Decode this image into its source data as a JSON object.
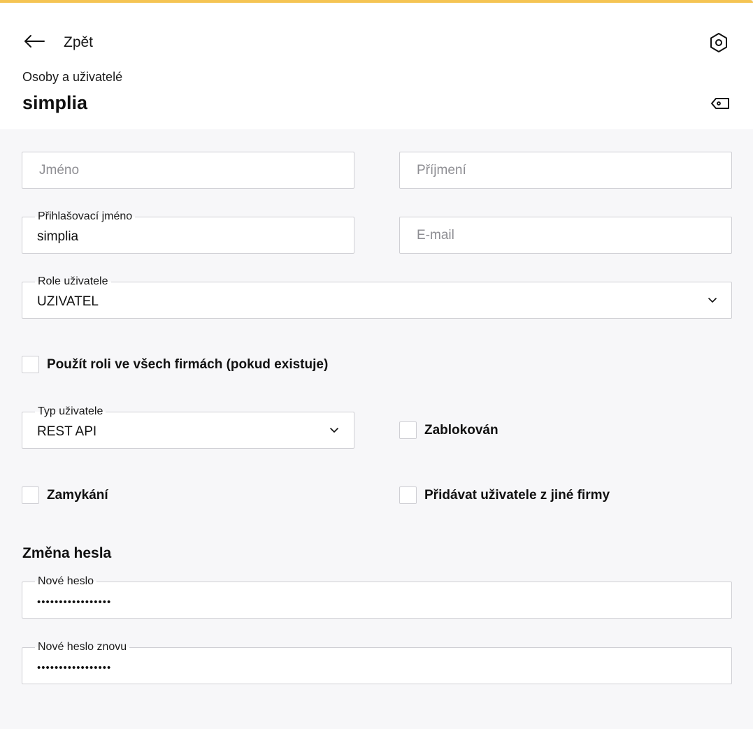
{
  "header": {
    "back_label": "Zpět",
    "subtitle": "Osoby a uživatelé",
    "title": "simplia",
    "settings_icon": "gear-hex-icon",
    "tag_icon": "tag-icon"
  },
  "form": {
    "first_name": {
      "placeholder": "Jméno",
      "value": ""
    },
    "last_name": {
      "placeholder": "Příjmení",
      "value": ""
    },
    "login": {
      "label": "Přihlašovací jméno",
      "value": "simplia"
    },
    "email": {
      "placeholder": "E-mail",
      "value": ""
    },
    "role": {
      "label": "Role uživatele",
      "value": "UZIVATEL"
    },
    "use_role_all_companies": {
      "label": "Použít roli ve všech firmách (pokud existuje)",
      "checked": false
    },
    "user_type": {
      "label": "Typ uživatele",
      "value": "REST API"
    },
    "blocked": {
      "label": "Zablokován",
      "checked": false
    },
    "locking": {
      "label": "Zamykání",
      "checked": false
    },
    "add_from_other_company": {
      "label": "Přidávat uživatele z jiné firmy",
      "checked": false
    }
  },
  "password": {
    "section_title": "Změna hesla",
    "new_password": {
      "label": "Nové heslo",
      "masked": "•••••••••••••••••"
    },
    "new_password_again": {
      "label": "Nové heslo znovu",
      "masked": "•••••••••••••••••"
    }
  },
  "colors": {
    "accent": "#f5c453",
    "background": "#f7f7f9",
    "field_border": "#cfcfd4"
  }
}
